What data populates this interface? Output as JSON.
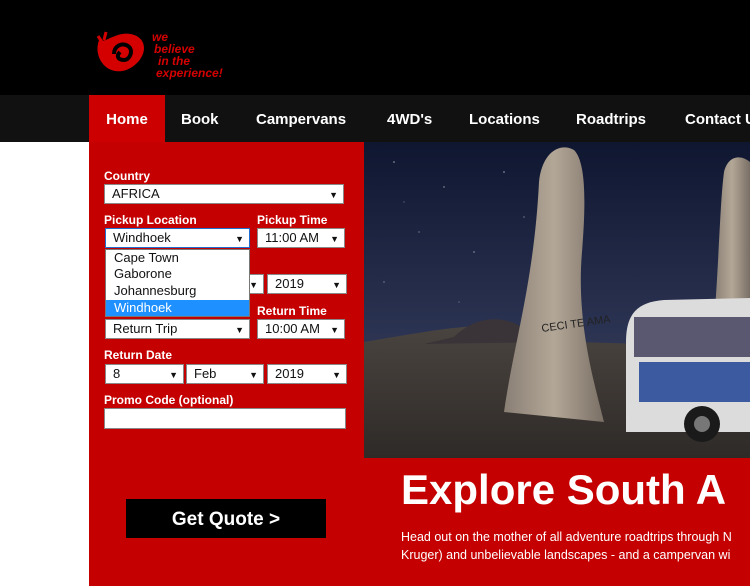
{
  "logo": {
    "line1": "we",
    "line2": "believe",
    "line3": "in the",
    "line4": "experience!"
  },
  "nav": [
    "Home",
    "Book",
    "Campervans",
    "4WD's",
    "Locations",
    "Roadtrips",
    "Contact Us"
  ],
  "form": {
    "country_label": "Country",
    "country_value": "AFRICA",
    "pickup_location_label": "Pickup Location",
    "pickup_location_value": "Windhoek",
    "pickup_time_label": "Pickup Time",
    "pickup_time_value": "11:00 AM",
    "pickup_year_value": "2019",
    "pickup_location_options": [
      "Cape Town",
      "Gaborone",
      "Johannesburg",
      "Windhoek"
    ],
    "return_time_label": "Return Time",
    "trip_type_value": "Return Trip",
    "return_time_value": "10:00 AM",
    "return_date_label": "Return Date",
    "return_day_value": "8",
    "return_month_value": "Feb",
    "return_year_value": "2019",
    "promo_label": "Promo Code (optional)",
    "promo_value": "",
    "quote_button": "Get Quote >"
  },
  "hero": {
    "headline": "Explore South A",
    "line1": "Head out on the mother of all adventure roadtrips through N",
    "line2": "Kruger) and unbelievable landscapes - and a campervan wi",
    "rock_text": "CECI TE AMA"
  },
  "colors": {
    "brand_red": "#c40000",
    "nav_bg": "#111111",
    "top_bg": "#000000",
    "selected_option": "#1e90ff"
  }
}
